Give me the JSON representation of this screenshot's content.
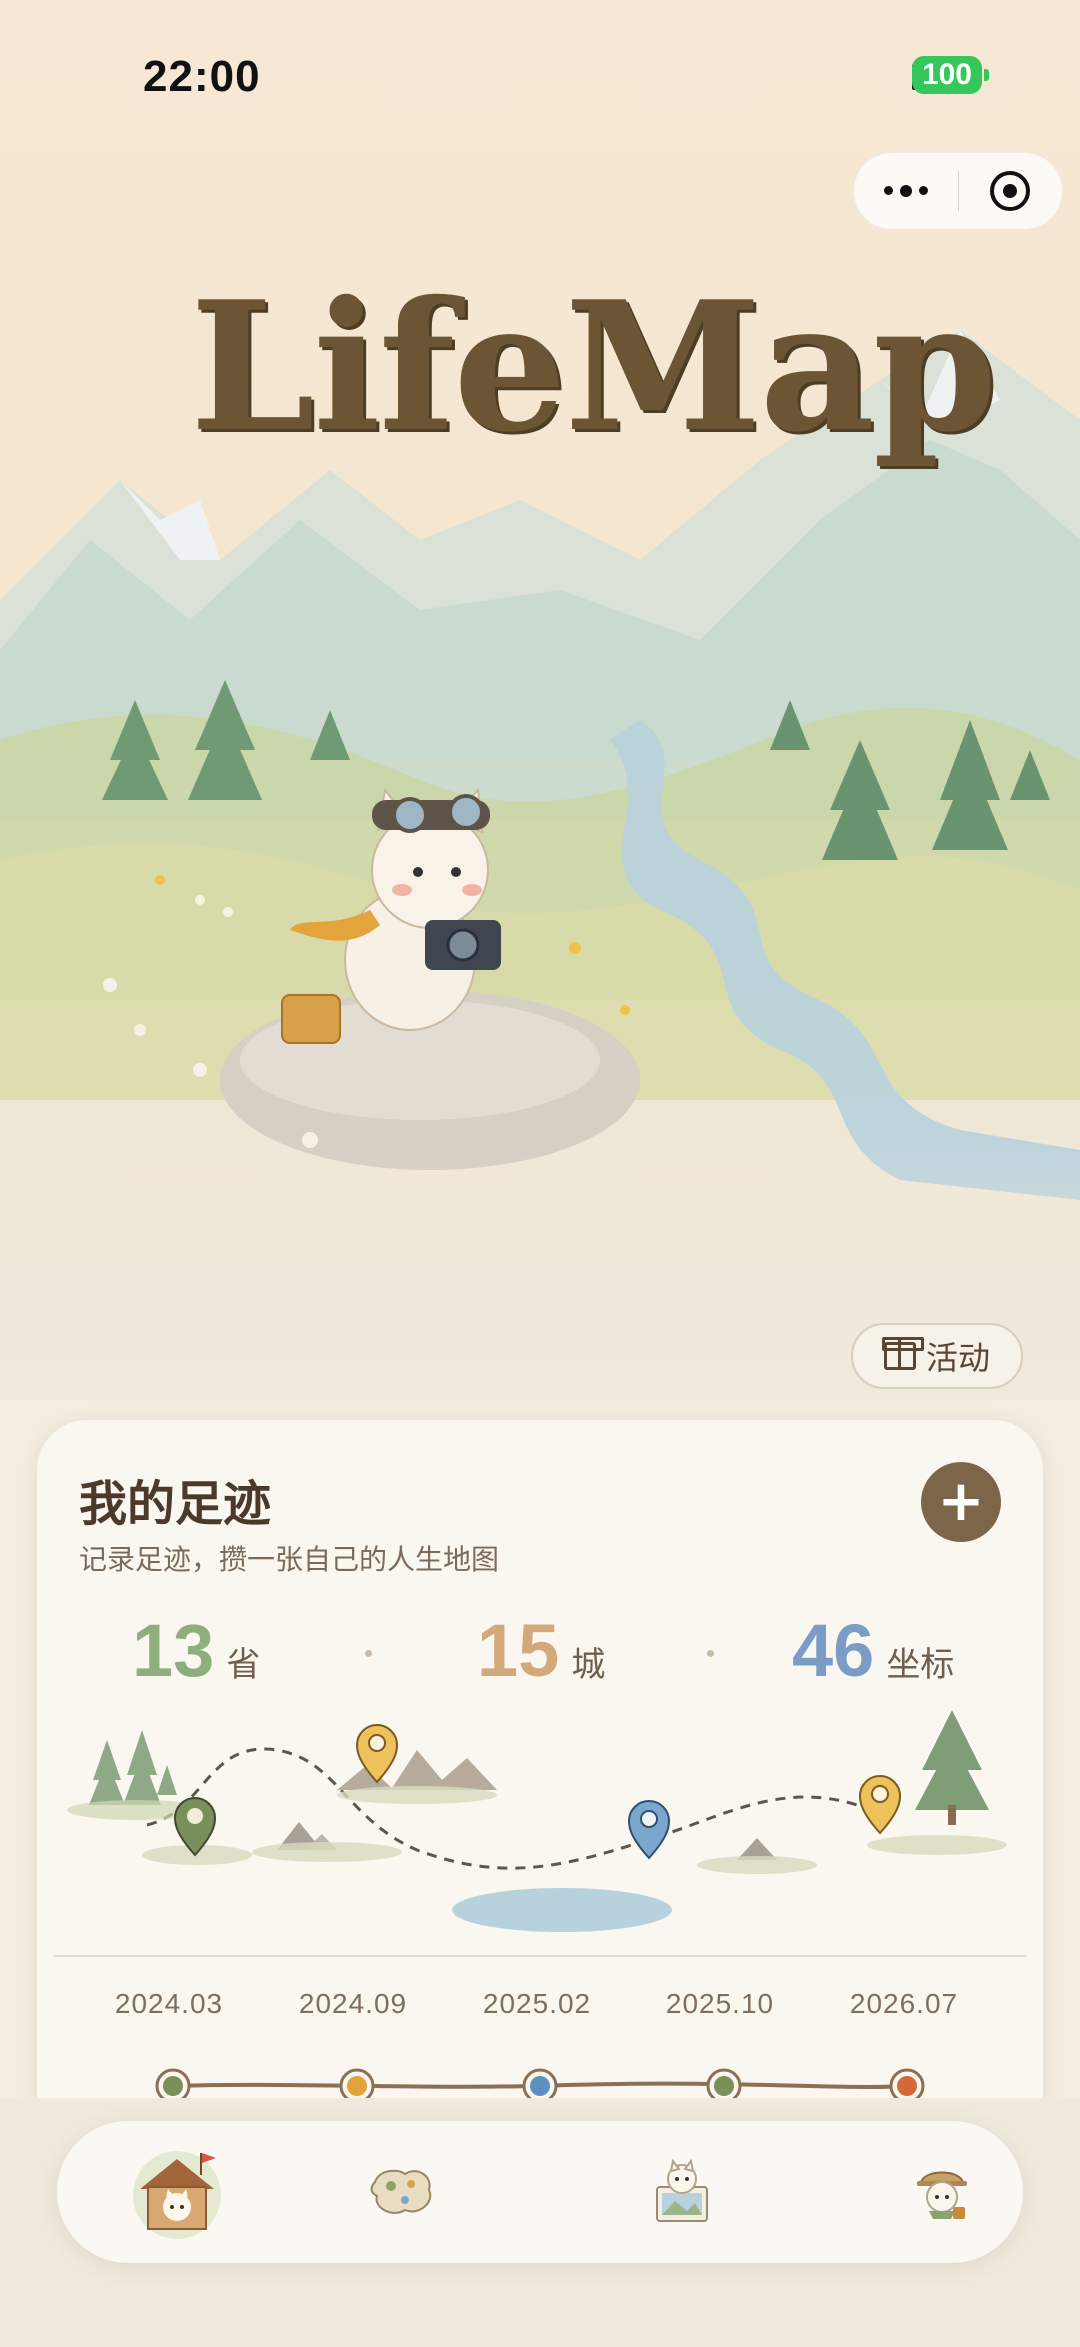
{
  "status_bar": {
    "time": "22:00",
    "battery": "100"
  },
  "logo": {
    "text": "LifeMap"
  },
  "activity_button": {
    "label": "活动"
  },
  "footprint_card": {
    "title": "我的足迹",
    "subtitle": "记录足迹，攒一张自己的人生地图",
    "stats": [
      {
        "value": "13",
        "unit": "省",
        "color": "#8fae7e"
      },
      {
        "value": "15",
        "unit": "城",
        "color": "#d3a87a"
      },
      {
        "value": "46",
        "unit": "坐标",
        "color": "#7b9cc7"
      }
    ],
    "dates": [
      "2024.03",
      "2024.09",
      "2025.02",
      "2025.10",
      "2026.07"
    ],
    "timeline_colors": [
      "#7a8f5a",
      "#e3a23a",
      "#5f8fbf",
      "#7a8f5a",
      "#d4683b"
    ]
  },
  "tab_bar": {
    "items": [
      {
        "icon": "cat-house-icon",
        "active": true
      },
      {
        "icon": "map-icon",
        "active": false
      },
      {
        "icon": "cat-photo-icon",
        "active": false
      },
      {
        "icon": "cat-explorer-icon",
        "active": false
      }
    ]
  }
}
